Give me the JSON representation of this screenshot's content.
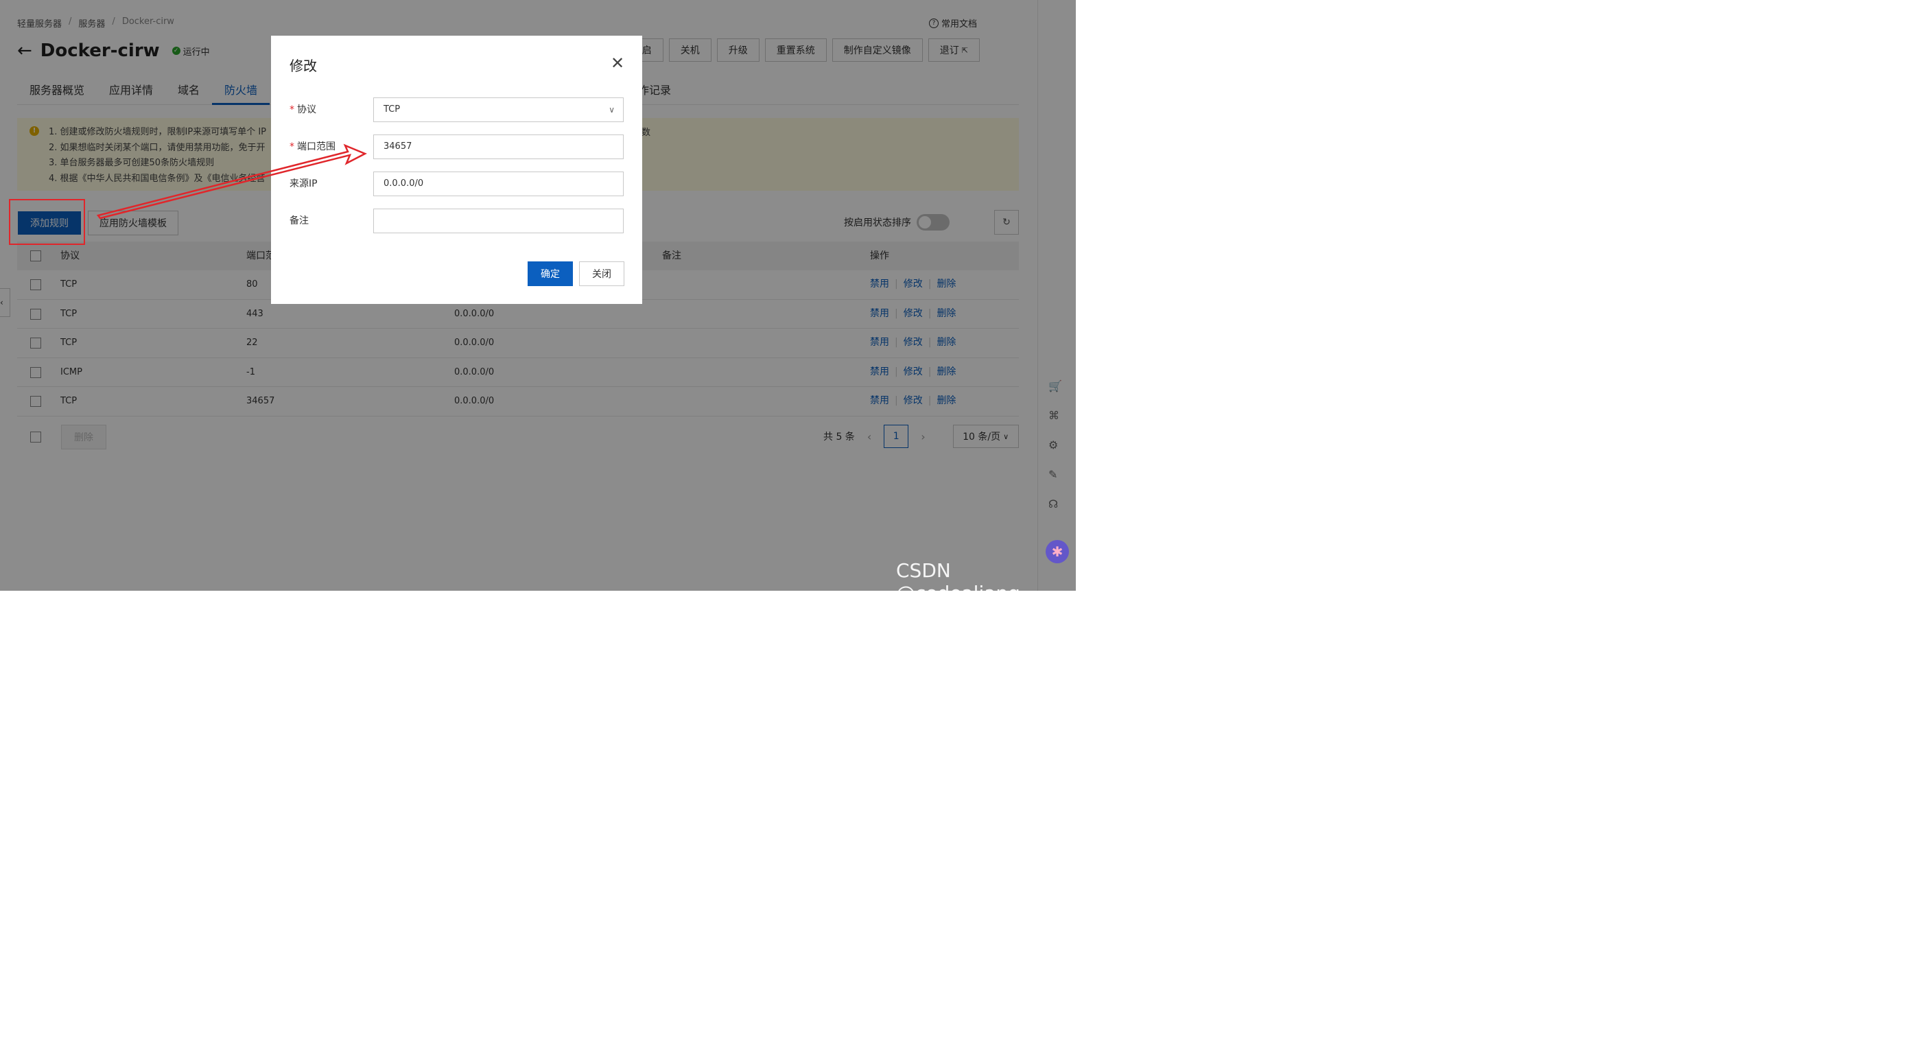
{
  "breadcrumb": [
    "轻量服务器",
    "服务器",
    "Docker-cirw"
  ],
  "help_link": "常用文档",
  "header": {
    "back_icon": "back-arrow-icon",
    "title": "Docker-cirw",
    "status": "运行中"
  },
  "top_actions": [
    "重启",
    "关机",
    "升级",
    "重置系统",
    "制作自定义镜像",
    "退订"
  ],
  "tabs": [
    "服务器概览",
    "应用详情",
    "域名",
    "防火墙"
  ],
  "tab_partial": "作记录",
  "notice": {
    "lines": [
      "1. 创建或修改防火墙规则时，限制IP来源可填写单个 IP",
      "2. 如果想临时关闭某个端口，请使用禁用功能，免于开",
      "3. 单台服务器最多可创建50条防火墙规则",
      "4. 根据《中华人民共和国电信条例》及《电信业务经营"
    ],
    "tail": "数"
  },
  "toolbar": {
    "add_rule": "添加规则",
    "apply_template": "应用防火墙模板",
    "sort_label": "按启用状态排序"
  },
  "table": {
    "headers": {
      "protocol": "协议",
      "port": "端口范",
      "remark": "备注",
      "ops": "操作"
    },
    "rows": [
      {
        "protocol": "TCP",
        "port": "80",
        "source": ""
      },
      {
        "protocol": "TCP",
        "port": "443",
        "source": "0.0.0.0/0"
      },
      {
        "protocol": "TCP",
        "port": "22",
        "source": "0.0.0.0/0"
      },
      {
        "protocol": "ICMP",
        "port": "-1",
        "source": "0.0.0.0/0"
      },
      {
        "protocol": "TCP",
        "port": "34657",
        "source": "0.0.0.0/0"
      }
    ],
    "row_actions": [
      "禁用",
      "修改",
      "删除"
    ]
  },
  "footer": {
    "delete": "删除",
    "total": "共 5 条",
    "page": "1",
    "page_size": "10 条/页"
  },
  "dialog": {
    "title": "修改",
    "fields": {
      "protocol_label": "协议",
      "protocol_value": "TCP",
      "port_label": "端口范围",
      "port_value": "34657",
      "source_label": "来源IP",
      "source_value": "0.0.0.0/0",
      "remark_label": "备注",
      "remark_value": ""
    },
    "ok": "确定",
    "cancel": "关闭"
  },
  "watermark": "CSDN @codealiang",
  "colors": {
    "primary": "#0b5fbf",
    "annotation_red": "#e0262b",
    "notice_bg": "#fffbe0"
  }
}
